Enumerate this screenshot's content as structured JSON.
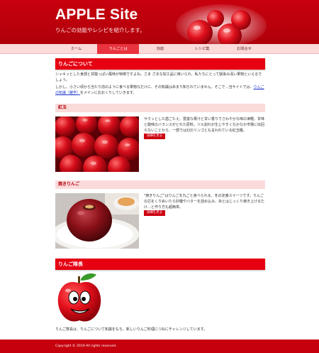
{
  "header": {
    "title": "APPLE Site",
    "subtitle": "りんごの効能やレシピを紹介します。"
  },
  "nav": {
    "items": [
      {
        "label": "ホーム"
      },
      {
        "label": "りんごとは"
      },
      {
        "label": "効能"
      },
      {
        "label": "レシピ集"
      },
      {
        "label": "お問合せ"
      }
    ],
    "active_index": 1
  },
  "about": {
    "heading": "りんごについて",
    "para1": "シャキッとした食感と甘酸っぱい風味が特徴ですよね。さま ざまな加工品に用いられ、私たちにとって馴染み深い果物といえるでしょう。",
    "para2_before": "しかし、小さい頃から当たり前のように食べる果物なだけに、その知識はあまり知られていません。そこで…当サイトでは、",
    "para2_link": "りんごの知識（雑学）",
    "para2_after": "をメインにおおくりしていきます。"
  },
  "kougyoku": {
    "heading": "紅玉",
    "text": "サクッとした歯ごたえ、豊富な果汁と甘い香りでさわやかな味の津軽。甘味と酸味のバランスがとれた原料。ツル割れが生じやすくなかなか市場に出回らないことから、一部では幻のリンゴとも言われている紅玉種。",
    "button": "詳細を見る"
  },
  "yaki": {
    "heading": "焼きりんご",
    "text": "\"焼きりんご\"はりんごを丸ごと食べられる、冬の定番スイーツです。りんごの芯をくりぬいたら砂糖やバターを詰め込み、あとはじっくり焼き上げるだけ…と作り方も超簡単。",
    "button": "詳細を見る"
  },
  "mascot": {
    "heading": "りんご隊長",
    "caption": "りんご隊長は、りんごについて知識をもち、新しいりんご料理につねにチャレンジしています。"
  },
  "footer": {
    "copyright": "Copyright © 2019 All rights reserved."
  },
  "colors": {
    "brand_red": "#c8000e",
    "heading_red": "#e60012",
    "nav_bg": "#fbdada",
    "nav_active": "#e9333e",
    "link_blue": "#1a33cc"
  }
}
